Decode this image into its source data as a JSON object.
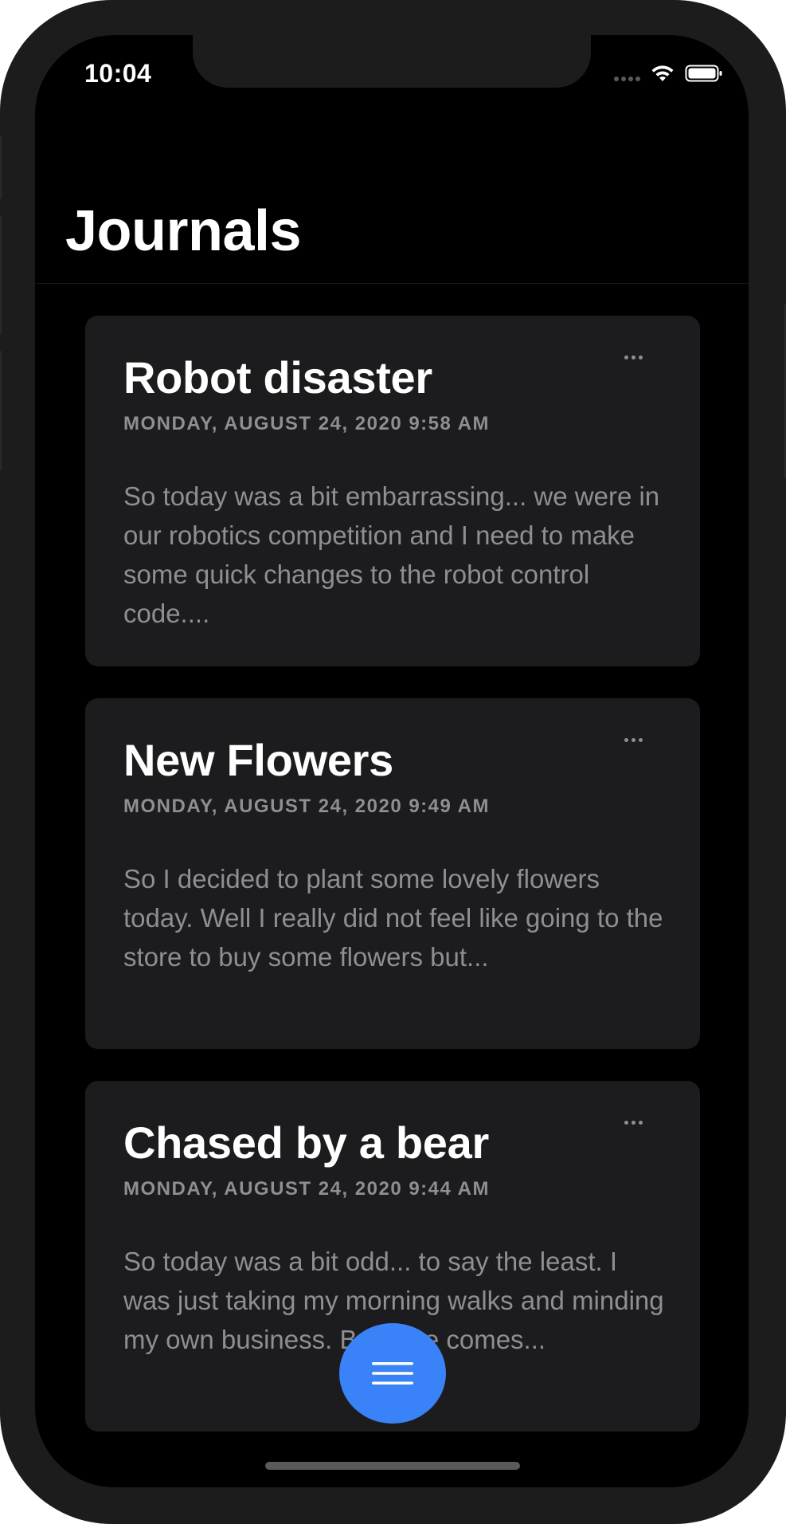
{
  "status_bar": {
    "time": "10:04",
    "icons": [
      "cellular-signal-icon",
      "wifi-icon",
      "battery-icon"
    ]
  },
  "header": {
    "title": "Journals"
  },
  "journals": [
    {
      "title": "Robot disaster",
      "date": "MONDAY, AUGUST 24, 2020 9:58 AM",
      "excerpt": "So today was a bit embarrassing... we were in our robotics competition and I need to make some quick changes to the robot control code...."
    },
    {
      "title": "New Flowers",
      "date": "MONDAY, AUGUST 24, 2020 9:49 AM",
      "excerpt": "So I decided to plant some lovely flowers today. Well I really did not feel like going to the store to buy some flowers but..."
    },
    {
      "title": "Chased by a bear",
      "date": "MONDAY, AUGUST 24, 2020 9:44 AM",
      "excerpt": "So today was a bit odd... to say the least. I was just taking my morning walks and minding my own business. But here comes..."
    }
  ],
  "fab": {
    "icon": "menu-icon",
    "color": "#3a82f7"
  },
  "colors": {
    "background": "#000000",
    "card": "#1c1c1e",
    "secondary_text": "#8e8e93",
    "accent": "#3a82f7"
  }
}
